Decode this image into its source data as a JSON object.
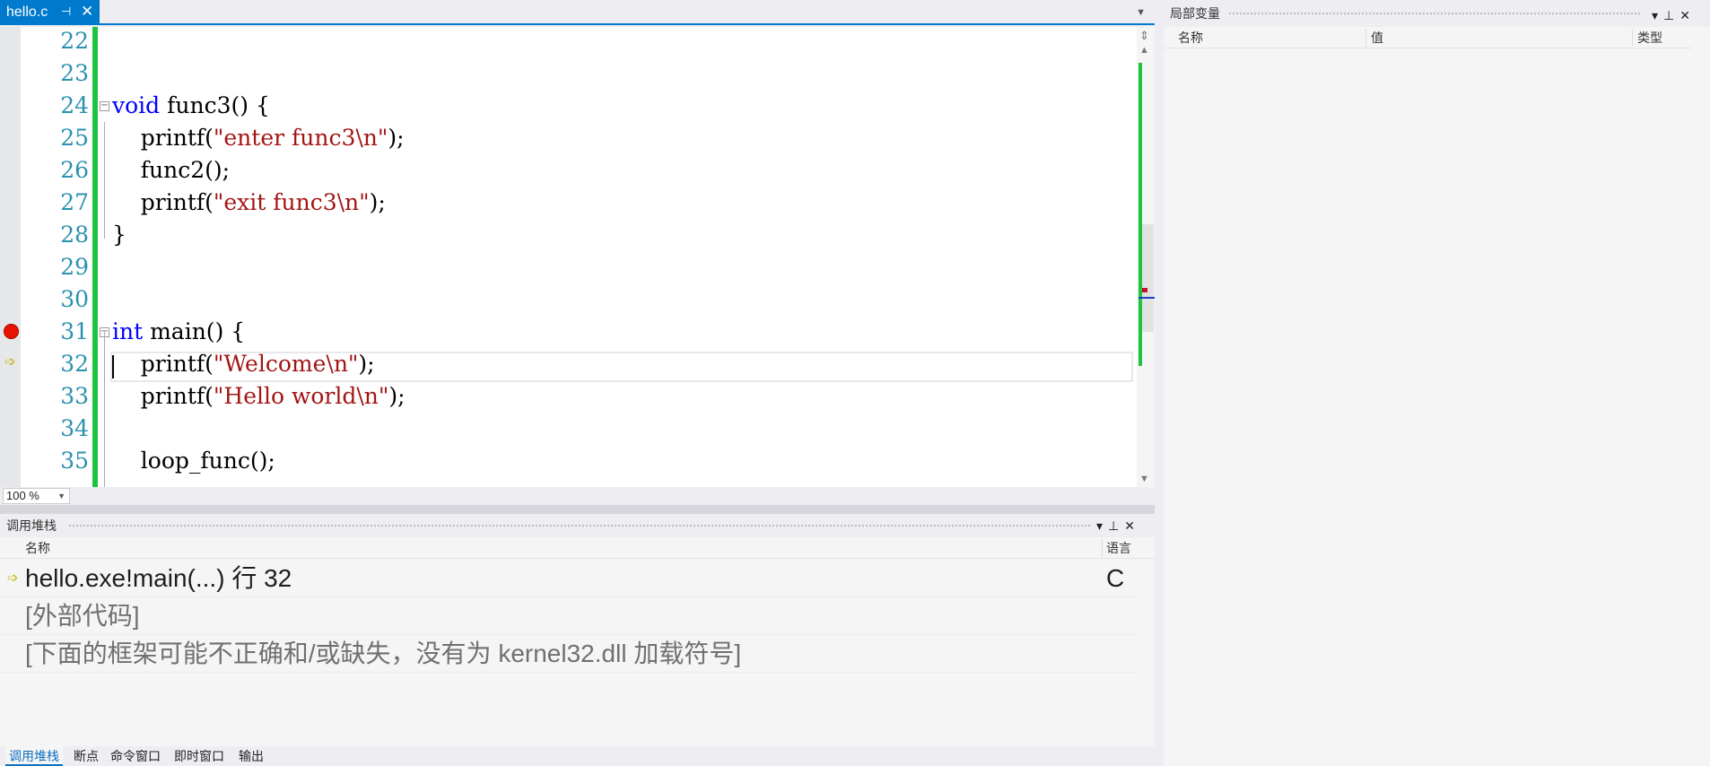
{
  "editor": {
    "tab": {
      "label": "hello.c",
      "pin_icon": "pin-icon",
      "close_icon": "close-icon"
    },
    "lines": [
      {
        "num": "22",
        "parts": []
      },
      {
        "num": "23",
        "parts": []
      },
      {
        "num": "24",
        "parts": [
          {
            "t": "void",
            "c": "kw"
          },
          {
            "t": " func3() {",
            "c": ""
          }
        ],
        "fold": true
      },
      {
        "num": "25",
        "parts": [
          {
            "t": "    printf(",
            "c": ""
          },
          {
            "t": "\"enter func3\\n\"",
            "c": "str"
          },
          {
            "t": ");",
            "c": ""
          }
        ]
      },
      {
        "num": "26",
        "parts": [
          {
            "t": "    func2();",
            "c": ""
          }
        ]
      },
      {
        "num": "27",
        "parts": [
          {
            "t": "    printf(",
            "c": ""
          },
          {
            "t": "\"exit func3\\n\"",
            "c": "str"
          },
          {
            "t": ");",
            "c": ""
          }
        ]
      },
      {
        "num": "28",
        "parts": [
          {
            "t": "}",
            "c": ""
          }
        ]
      },
      {
        "num": "29",
        "parts": []
      },
      {
        "num": "30",
        "parts": []
      },
      {
        "num": "31",
        "parts": [
          {
            "t": "int",
            "c": "kw"
          },
          {
            "t": " main() {",
            "c": ""
          }
        ],
        "fold": true,
        "breakpoint": true
      },
      {
        "num": "32",
        "parts": [
          {
            "t": "    printf(",
            "c": ""
          },
          {
            "t": "\"Welcome\\n\"",
            "c": "str"
          },
          {
            "t": ");",
            "c": ""
          }
        ],
        "current": true
      },
      {
        "num": "33",
        "parts": [
          {
            "t": "    printf(",
            "c": ""
          },
          {
            "t": "\"Hello world\\n\"",
            "c": "str"
          },
          {
            "t": ");",
            "c": ""
          }
        ]
      },
      {
        "num": "34",
        "parts": []
      },
      {
        "num": "35",
        "parts": [
          {
            "t": "    loop_func();",
            "c": ""
          }
        ]
      }
    ],
    "zoom": "100 %"
  },
  "callstack": {
    "title": "调用堆栈",
    "columns": {
      "name": "名称",
      "language": "语言"
    },
    "rows": [
      {
        "name": "hello.exe!main(...) 行 32",
        "language": "C",
        "current": true
      },
      {
        "name": "[外部代码]",
        "language": "",
        "muted": true
      },
      {
        "name": "[下面的框架可能不正确和/或缺失，没有为 kernel32.dll 加载符号]",
        "language": "",
        "muted": true
      }
    ]
  },
  "bottom_tabs": [
    "调用堆栈",
    "断点",
    "命令窗口",
    "即时窗口",
    "输出"
  ],
  "locals": {
    "title": "局部变量",
    "columns": {
      "name": "名称",
      "value": "值",
      "type": "类型"
    }
  },
  "colors": {
    "accent": "#007acc",
    "keyword": "#0000ff",
    "string": "#a31515",
    "line_number": "#2b91af",
    "change_bar": "#1ec33f",
    "breakpoint": "#e51400"
  }
}
